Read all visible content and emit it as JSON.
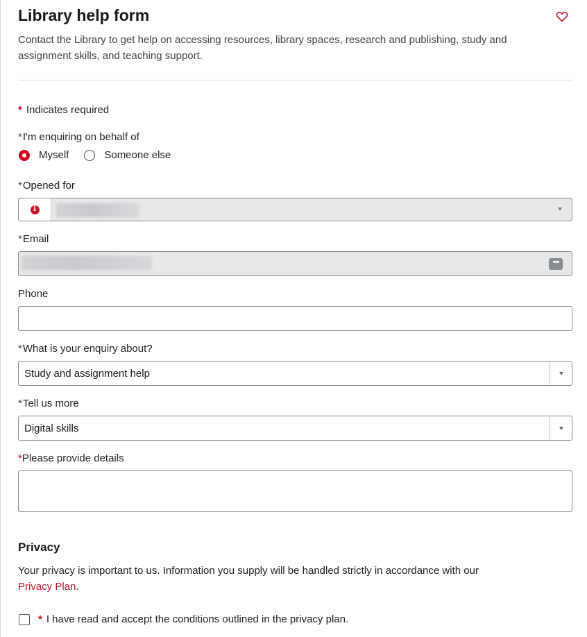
{
  "header": {
    "title": "Library help form",
    "subtitle": "Contact the Library to get help on accessing resources, library spaces, research and publishing, study and assignment skills, and teaching support.",
    "favorite_icon": "heart-outline-icon"
  },
  "form": {
    "required_marker": "*",
    "required_note": "Indicates required",
    "on_behalf": {
      "label": "I'm enquiring on behalf of",
      "options": [
        "Myself",
        "Someone else"
      ],
      "selected": "Myself"
    },
    "opened_for": {
      "label": "Opened for",
      "info_icon": "info-icon"
    },
    "email": {
      "label": "Email",
      "icon": "more-dots-icon"
    },
    "phone": {
      "label": "Phone",
      "value": ""
    },
    "enquiry_about": {
      "label": "What is your enquiry about?",
      "value": "Study and assignment help"
    },
    "tell_us_more": {
      "label": "Tell us more",
      "value": "Digital skills"
    },
    "details": {
      "label": "Please provide details",
      "value": ""
    }
  },
  "privacy": {
    "heading": "Privacy",
    "text": "Your privacy is important to us. Information you supply will be handled strictly in accordance with our",
    "link_text": "Privacy Plan",
    "text_end": ".",
    "consent_label": "I have read and accept the conditions outlined in the privacy plan."
  },
  "colors": {
    "accent_red": "#d0021b",
    "link_red": "#c4142a",
    "readonly_bg": "#e6e7e8"
  }
}
